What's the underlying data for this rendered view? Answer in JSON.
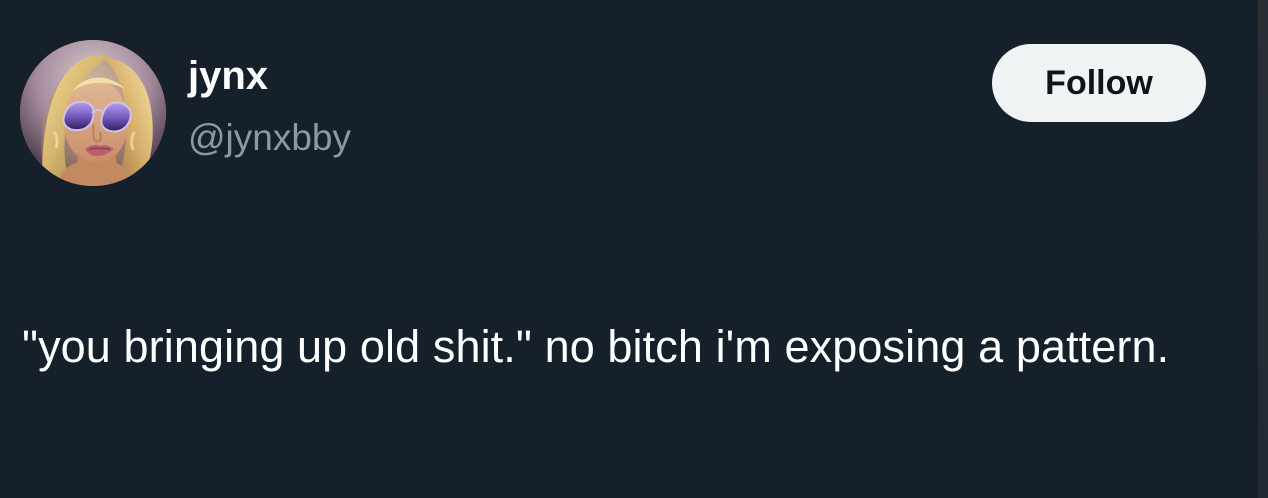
{
  "profile": {
    "display_name": "jynx",
    "handle": "@jynxbby",
    "avatar_icon": "profile-photo-icon"
  },
  "actions": {
    "follow_label": "Follow"
  },
  "post": {
    "text": "\"you bringing up old shit.\" no bitch i'm exposing a pattern."
  },
  "colors": {
    "background": "#15202b",
    "primary_text": "#ffffff",
    "secondary_text": "#8b98a5",
    "button_background": "#eff3f4",
    "button_text": "#0f1419"
  }
}
